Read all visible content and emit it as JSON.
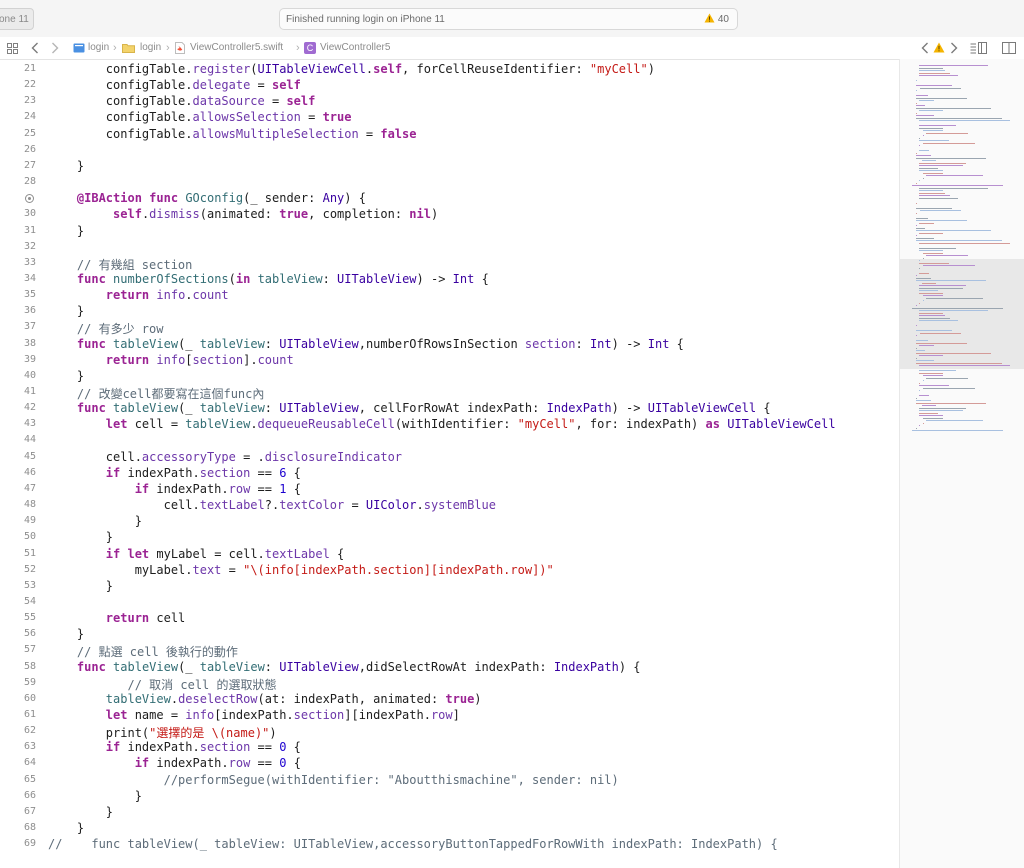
{
  "toolbar": {
    "device_tab": "one 11",
    "status": "Finished running login on iPhone 11",
    "warnings": "40"
  },
  "jumpbar": {
    "crumbs": [
      "login",
      "login",
      "ViewController5.swift",
      "ViewController5"
    ]
  },
  "colors": {
    "keyword": "#9b2393",
    "type": "#3900a0",
    "string": "#c41a16",
    "comment": "#5d6c79",
    "warning": "#f5b400"
  },
  "editor": {
    "lines": [
      {
        "n": "21",
        "t": "        configTable.register(UITableViewCell.self, forCellReuseIdentifier: \"myCell\")"
      },
      {
        "n": "22",
        "t": "        configTable.delegate = self"
      },
      {
        "n": "23",
        "t": "        configTable.dataSource = self"
      },
      {
        "n": "24",
        "t": "        configTable.allowsSelection = true"
      },
      {
        "n": "25",
        "t": "        configTable.allowsMultipleSelection = false"
      },
      {
        "n": "26",
        "t": ""
      },
      {
        "n": "27",
        "t": "    }"
      },
      {
        "n": "28",
        "t": ""
      },
      {
        "n": "",
        "t": "    @IBAction func GOconfig(_ sender: Any) {",
        "bp": true
      },
      {
        "n": "30",
        "t": "         self.dismiss(animated: true, completion: nil)"
      },
      {
        "n": "31",
        "t": "    }"
      },
      {
        "n": "32",
        "t": ""
      },
      {
        "n": "33",
        "t": "    // 有幾組 section"
      },
      {
        "n": "34",
        "t": "    func numberOfSections(in tableView: UITableView) -> Int {"
      },
      {
        "n": "35",
        "t": "        return info.count"
      },
      {
        "n": "36",
        "t": "    }"
      },
      {
        "n": "37",
        "t": "    // 有多少 row"
      },
      {
        "n": "38",
        "t": "    func tableView(_ tableView: UITableView,numberOfRowsInSection section: Int) -> Int {"
      },
      {
        "n": "39",
        "t": "        return info[section].count"
      },
      {
        "n": "40",
        "t": "    }"
      },
      {
        "n": "41",
        "t": "    // 改變cell都要寫在這個func內"
      },
      {
        "n": "42",
        "t": "    func tableView(_ tableView: UITableView, cellForRowAt indexPath: IndexPath) -> UITableViewCell {"
      },
      {
        "n": "43",
        "t": "        let cell = tableView.dequeueReusableCell(withIdentifier: \"myCell\", for: indexPath) as UITableViewCell"
      },
      {
        "n": "44",
        "t": ""
      },
      {
        "n": "45",
        "t": "        cell.accessoryType = .disclosureIndicator"
      },
      {
        "n": "46",
        "t": "        if indexPath.section == 6 {"
      },
      {
        "n": "47",
        "t": "            if indexPath.row == 1 {"
      },
      {
        "n": "48",
        "t": "                cell.textLabel?.textColor = UIColor.systemBlue"
      },
      {
        "n": "49",
        "t": "            }"
      },
      {
        "n": "50",
        "t": "        }"
      },
      {
        "n": "51",
        "t": "        if let myLabel = cell.textLabel {"
      },
      {
        "n": "52",
        "t": "            myLabel.text = \"\\(info[indexPath.section][indexPath.row])\""
      },
      {
        "n": "53",
        "t": "        }"
      },
      {
        "n": "54",
        "t": ""
      },
      {
        "n": "55",
        "t": "        return cell"
      },
      {
        "n": "56",
        "t": "    }"
      },
      {
        "n": "57",
        "t": "    // 點選 cell 後執行的動作"
      },
      {
        "n": "58",
        "t": "    func tableView(_ tableView: UITableView,didSelectRowAt indexPath: IndexPath) {"
      },
      {
        "n": "59",
        "t": "           // 取消 cell 的選取狀態"
      },
      {
        "n": "60",
        "t": "        tableView.deselectRow(at: indexPath, animated: true)"
      },
      {
        "n": "61",
        "t": "        let name = info[indexPath.section][indexPath.row]"
      },
      {
        "n": "62",
        "t": "        print(\"選擇的是 \\(name)\")"
      },
      {
        "n": "63",
        "t": "        if indexPath.section == 0 {"
      },
      {
        "n": "64",
        "t": "            if indexPath.row == 0 {"
      },
      {
        "n": "65",
        "t": "                //performSegue(withIdentifier: \"Aboutthismachine\", sender: nil)"
      },
      {
        "n": "66",
        "t": "            }"
      },
      {
        "n": "67",
        "t": "        }"
      },
      {
        "n": "68",
        "t": "    }"
      },
      {
        "n": "69",
        "t": "//    func tableView(_ tableView: UITableView,accessoryButtonTappedForRowWith indexPath: IndexPath) {"
      }
    ]
  }
}
